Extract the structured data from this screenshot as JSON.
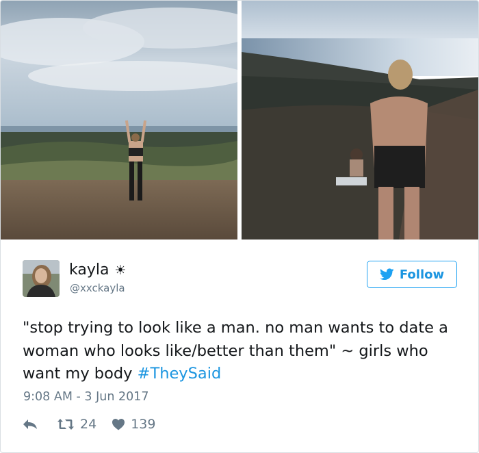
{
  "user": {
    "display_name": "kayla",
    "name_emoji": "☀",
    "handle": "@xxckayla"
  },
  "follow_button": {
    "label": "Follow"
  },
  "tweet": {
    "text_parts": [
      "\"stop trying to look like a man. no man wants to date a woman who looks like/better than them\" ~ girls who want my body ",
      "#TheySaid"
    ],
    "timestamp": "9:08 AM - 3 Jun 2017"
  },
  "actions": {
    "retweet_count": "24",
    "like_count": "139"
  },
  "colors": {
    "link_blue": "#1b95e0",
    "muted": "#657786",
    "text": "#14171a"
  },
  "icons": [
    "reply-icon",
    "retweet-icon",
    "heart-icon",
    "twitter-bird-icon",
    "sun-icon"
  ]
}
